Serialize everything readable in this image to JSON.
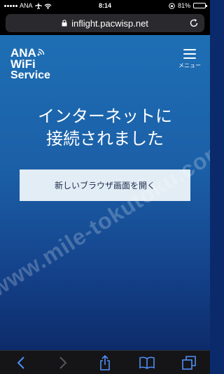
{
  "status_bar": {
    "carrier": "ANA",
    "time": "8:14",
    "battery": "81%",
    "battery_level": 0.81,
    "icons": [
      "signal-dots",
      "airplane-icon",
      "wifi-icon",
      "orientation-lock-icon",
      "battery-icon"
    ]
  },
  "browser": {
    "url": "inflight.pacwisp.net",
    "icons": [
      "lock-icon",
      "reload-icon"
    ]
  },
  "site": {
    "logo_line1": "ANA",
    "logo_line2": "WiFi",
    "logo_line3": "Service",
    "menu_label": "メニュー",
    "headline_line1": "インターネットに",
    "headline_line2": "接続されました",
    "open_button": "新しいブラウザ画面を開く"
  },
  "watermark": "www.mile-tokutoku.com",
  "toolbar": {
    "icons": [
      "back-icon",
      "forward-icon",
      "share-icon",
      "bookmarks-icon",
      "tabs-icon"
    ]
  },
  "colors": {
    "accent_blue": "#1e6fb5",
    "deep_blue": "#0d2b6a",
    "button_bg": "#e3edf5"
  }
}
